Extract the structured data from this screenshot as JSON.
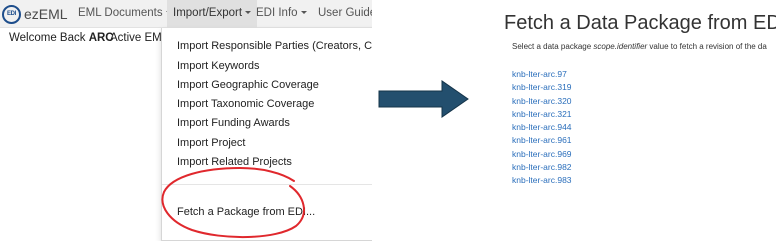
{
  "left_panel": {
    "brand": {
      "logo_text": "EDI",
      "name": "ezEML"
    },
    "nav": [
      {
        "label": "EML Documents"
      },
      {
        "label": "Import/Export"
      },
      {
        "label": "EDI Info"
      },
      {
        "label": "User Guide"
      }
    ],
    "subbar": {
      "welcome_prefix": "Welcome Back ",
      "user": "ARC",
      "active_doc": "Active EML D"
    },
    "dropdown": {
      "items": [
        "Import Responsible Parties (Creators, Contacts",
        "Import Keywords",
        "Import Geographic Coverage",
        "Import Taxonomic Coverage",
        "Import Funding Awards",
        "Import Project",
        "Import Related Projects"
      ],
      "highlighted_item": "Fetch a Package from EDI..."
    },
    "annotation_color": "#e0282d"
  },
  "arrow": {
    "fill": "#234f6e",
    "stroke": "#153449"
  },
  "right_panel": {
    "title": "Fetch a Data Package from EDI",
    "help_icon": "?",
    "description_prefix": "Select a data package ",
    "description_term": "scope.identifier",
    "description_suffix": " value to fetch a revision of the da",
    "packages": [
      "knb-lter-arc.97",
      "knb-lter-arc.319",
      "knb-lter-arc.320",
      "knb-lter-arc.321",
      "knb-lter-arc.944",
      "knb-lter-arc.961",
      "knb-lter-arc.969",
      "knb-lter-arc.982",
      "knb-lter-arc.983"
    ],
    "link_color": "#2a6ebb"
  }
}
